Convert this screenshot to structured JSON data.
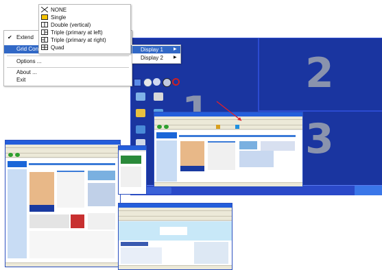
{
  "desktop": {
    "zones": [
      "1",
      "2",
      "3"
    ]
  },
  "context_menu": {
    "items": [
      {
        "label": "Extend",
        "checked": true
      },
      {
        "label": "Grid Con",
        "highlighted": true
      },
      {
        "label": "Options ..."
      },
      {
        "label": "About ..."
      },
      {
        "label": "Exit"
      }
    ]
  },
  "grid_submenu": {
    "items": [
      {
        "label": "NONE",
        "icon": "none-x-icon"
      },
      {
        "label": "Single",
        "icon": "single-grid-icon",
        "icon_color": "#f5c400"
      },
      {
        "label": "Double (vertical)",
        "icon": "double-vertical-grid-icon"
      },
      {
        "label": "Triple (primary at left)",
        "icon": "triple-left-grid-icon"
      },
      {
        "label": "Triple (primary at right)",
        "icon": "triple-right-grid-icon"
      },
      {
        "label": "Quad",
        "icon": "quad-grid-icon"
      }
    ]
  },
  "display_submenu": {
    "items": [
      {
        "label": "Display 1",
        "highlighted": true
      },
      {
        "label": "Display 2"
      }
    ]
  },
  "colors": {
    "accent": "#3168c6",
    "desktop_blue": "#1f3aa8",
    "zone_number": "#8a93ad",
    "arrow": "#e0202a"
  }
}
